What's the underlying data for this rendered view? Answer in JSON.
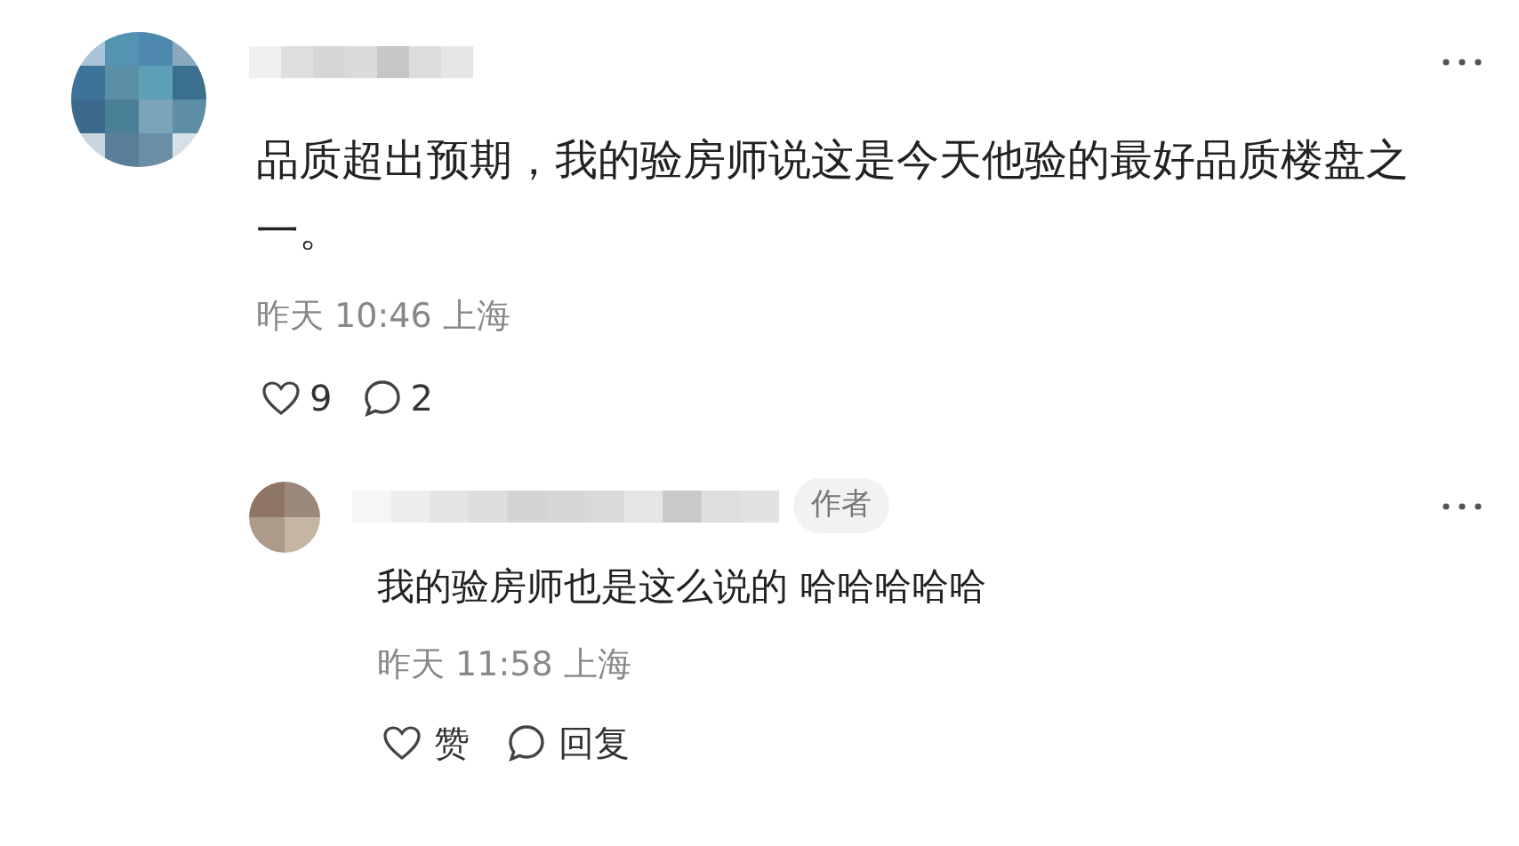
{
  "comment": {
    "text": "品质超出预期，我的验房师说这是今天他验的最好品质楼盘之一。",
    "time": "昨天 10:46 上海",
    "like_count": "9",
    "reply_count": "2"
  },
  "reply": {
    "badge": "作者",
    "text": "我的验房师也是这么说的 哈哈哈哈哈",
    "time": "昨天 11:58 上海",
    "like_label": "赞",
    "reply_label": "回复"
  }
}
